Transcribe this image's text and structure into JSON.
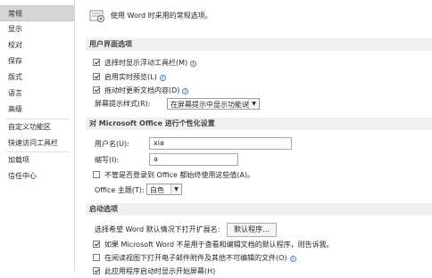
{
  "sidebar": {
    "items": [
      {
        "label": "常规",
        "selected": true
      },
      {
        "label": "显示"
      },
      {
        "label": "校对"
      },
      {
        "label": "保存"
      },
      {
        "label": "版式"
      },
      {
        "label": "语言"
      },
      {
        "label": "高级"
      },
      {
        "label": "自定义功能区"
      },
      {
        "label": "快速访问工具栏"
      },
      {
        "label": "加载项"
      },
      {
        "label": "信任中心"
      }
    ]
  },
  "main": {
    "intro": "使用 Word 时采用的常规选项。",
    "ui_section": {
      "title": "用户界面选项",
      "mini_toolbar": "选择时显示浮动工具栏(M)",
      "live_preview": "启用实时预览(L)",
      "update_on_drag": "拖动时更新文档内容(D)",
      "screentip_label": "屏幕提示样式(R):",
      "screentip_value": "在屏幕提示中显示功能说明"
    },
    "personalize_section": {
      "title": "对 Microsoft Office 进行个性化设置",
      "username_label": "用户名(U):",
      "username_value": "xia",
      "initials_label": "缩写(I):",
      "initials_value": "a",
      "always_use": "不管是否登录到 Office 都始终使用这些值(A)。",
      "theme_label": "Office 主题(T):",
      "theme_value": "白色"
    },
    "startup_section": {
      "title": "启动选项",
      "default_ext_label": "选择希望 Word 默认情况下打开扩展名:",
      "default_programs_button": "默认程序...",
      "tell_me_default": "如果 Microsoft Word 不是用于查看和编辑文档的默认程序，则告诉我。",
      "reading_view": "在阅读视图下打开电子邮件附件及其他不可编辑的文件(O)",
      "start_screen": "此应用程序启动时显示开始屏幕(H)"
    }
  },
  "colors": {
    "selected_nav": "#d5d5d5",
    "section_bg": "#f0f0f0",
    "info_icon": "#4a7cc3"
  }
}
